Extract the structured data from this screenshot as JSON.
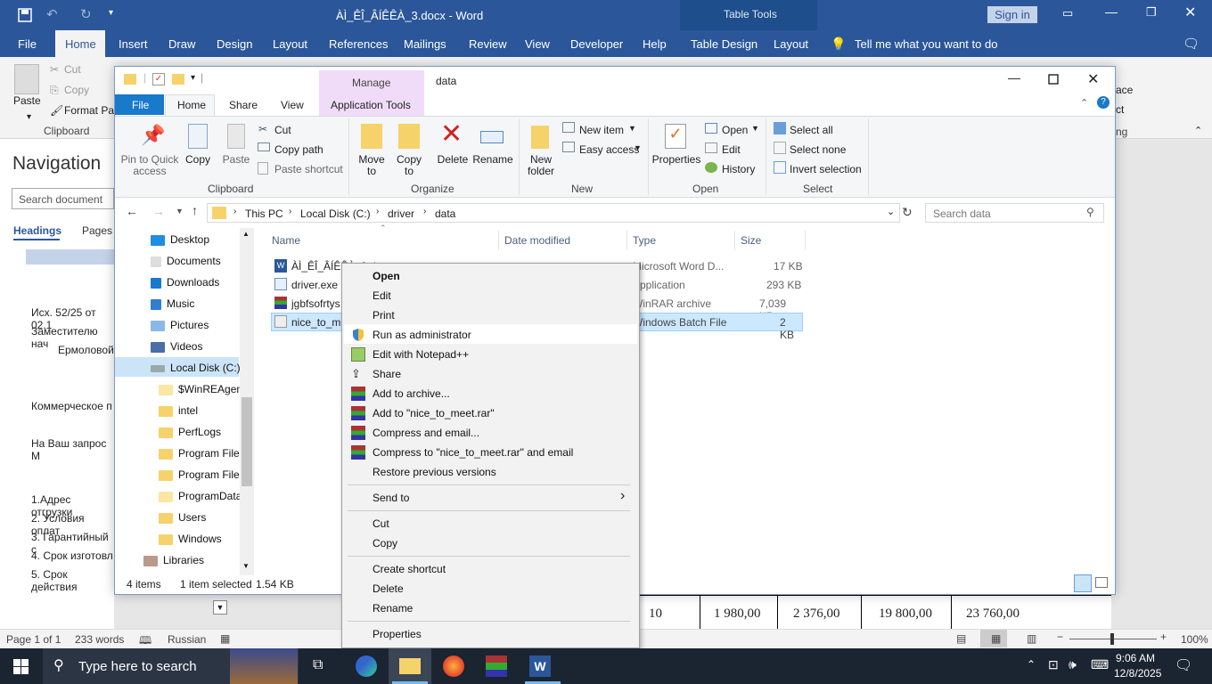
{
  "word": {
    "title": "ÀÌ_ÊÎ_ÂÍÊÊÀ_3.docx  -  Word",
    "table_tools": "Table Tools",
    "sign_in": "Sign in",
    "tabs": [
      "File",
      "Home",
      "Insert",
      "Draw",
      "Design",
      "Layout",
      "References",
      "Mailings",
      "Review",
      "View",
      "Developer",
      "Help",
      "Table Design",
      "Layout"
    ],
    "tell_me": "Tell me what you want to do",
    "clipboard": {
      "paste": "Paste",
      "cut": "Cut",
      "copy": "Copy",
      "format_painter": "Format Pa",
      "group": "Clipboard"
    },
    "right_frag": {
      "replace": "ace",
      "select": "ct",
      "editing": "ng"
    },
    "nav": {
      "title": "Navigation",
      "search": "Search document",
      "headings": "Headings",
      "pages": "Pages"
    },
    "doc_lines": [
      "Исх. 52/25 от 02.1",
      "Заместителю нач",
      "Ермоловой",
      "Коммерческое п",
      "На Ваш запрос М",
      "1.Адрес отгрузки",
      "2. Условия оплат",
      "3. Гарантийный с",
      "4. Срок изготовл",
      "5. Срок действия"
    ],
    "table_row": [
      "10",
      "1 980,00",
      "2 376,00",
      "19 800,00",
      "23 760,00"
    ],
    "status": {
      "page": "Page 1 of 1",
      "words": "233 words",
      "lang": "Russian",
      "zoom": "100%"
    }
  },
  "explorer": {
    "title": "data",
    "manage": "Manage",
    "app_tools": "Application Tools",
    "tabs": [
      "File",
      "Home",
      "Share",
      "View"
    ],
    "ribbon": {
      "pin": "Pin to Quick access",
      "copy": "Copy",
      "paste": "Paste",
      "cut": "Cut",
      "copy_path": "Copy path",
      "paste_shortcut": "Paste shortcut",
      "clipboard": "Clipboard",
      "move_to": "Move to",
      "copy_to": "Copy to",
      "delete": "Delete",
      "rename": "Rename",
      "organize": "Organize",
      "new_folder": "New folder",
      "new_item": "New item",
      "easy_access": "Easy access",
      "new": "New",
      "properties": "Properties",
      "open": "Open",
      "edit": "Edit",
      "history": "History",
      "open_group": "Open",
      "select_all": "Select all",
      "select_none": "Select none",
      "invert": "Invert selection",
      "select_group": "Select"
    },
    "breadcrumb": [
      "This PC",
      "Local Disk (C:)",
      "driver",
      "data"
    ],
    "search_placeholder": "Search data",
    "columns": [
      "Name",
      "Date modified",
      "Type",
      "Size"
    ],
    "files": [
      {
        "name": "ÀÌ_ÊÎ_ÂÍÊÊÀ_3.docx",
        "date": "",
        "type": "Microsoft Word D...",
        "size": "17 KB"
      },
      {
        "name": "driver.exe",
        "date": "",
        "type": "Application",
        "size": "293 KB"
      },
      {
        "name": "jgbfsofrtys",
        "date": "",
        "type": "WinRAR archive",
        "size": "7,039 KB"
      },
      {
        "name": "nice_to_meet",
        "date": "",
        "type": "Windows Batch File",
        "size": "2 KB"
      }
    ],
    "tree": [
      "Desktop",
      "Documents",
      "Downloads",
      "Music",
      "Pictures",
      "Videos",
      "Local Disk (C:)",
      "$WinREAgent",
      "intel",
      "PerfLogs",
      "Program Files",
      "Program Files",
      "ProgramData",
      "Users",
      "Windows",
      "Libraries"
    ],
    "status": {
      "count": "4 items",
      "selected": "1 item selected",
      "size": "1.54 KB"
    }
  },
  "context_menu": [
    "Open",
    "Edit",
    "Print",
    "Run as administrator",
    "Edit with Notepad++",
    "Share",
    "Add to archive...",
    "Add to \"nice_to_meet.rar\"",
    "Compress and email...",
    "Compress to \"nice_to_meet.rar\" and email",
    "Restore previous versions",
    "Send to",
    "Cut",
    "Copy",
    "Create shortcut",
    "Delete",
    "Rename",
    "Properties"
  ],
  "taskbar": {
    "search": "Type here to search",
    "time": "9:06 AM",
    "date": "12/8/2025"
  }
}
